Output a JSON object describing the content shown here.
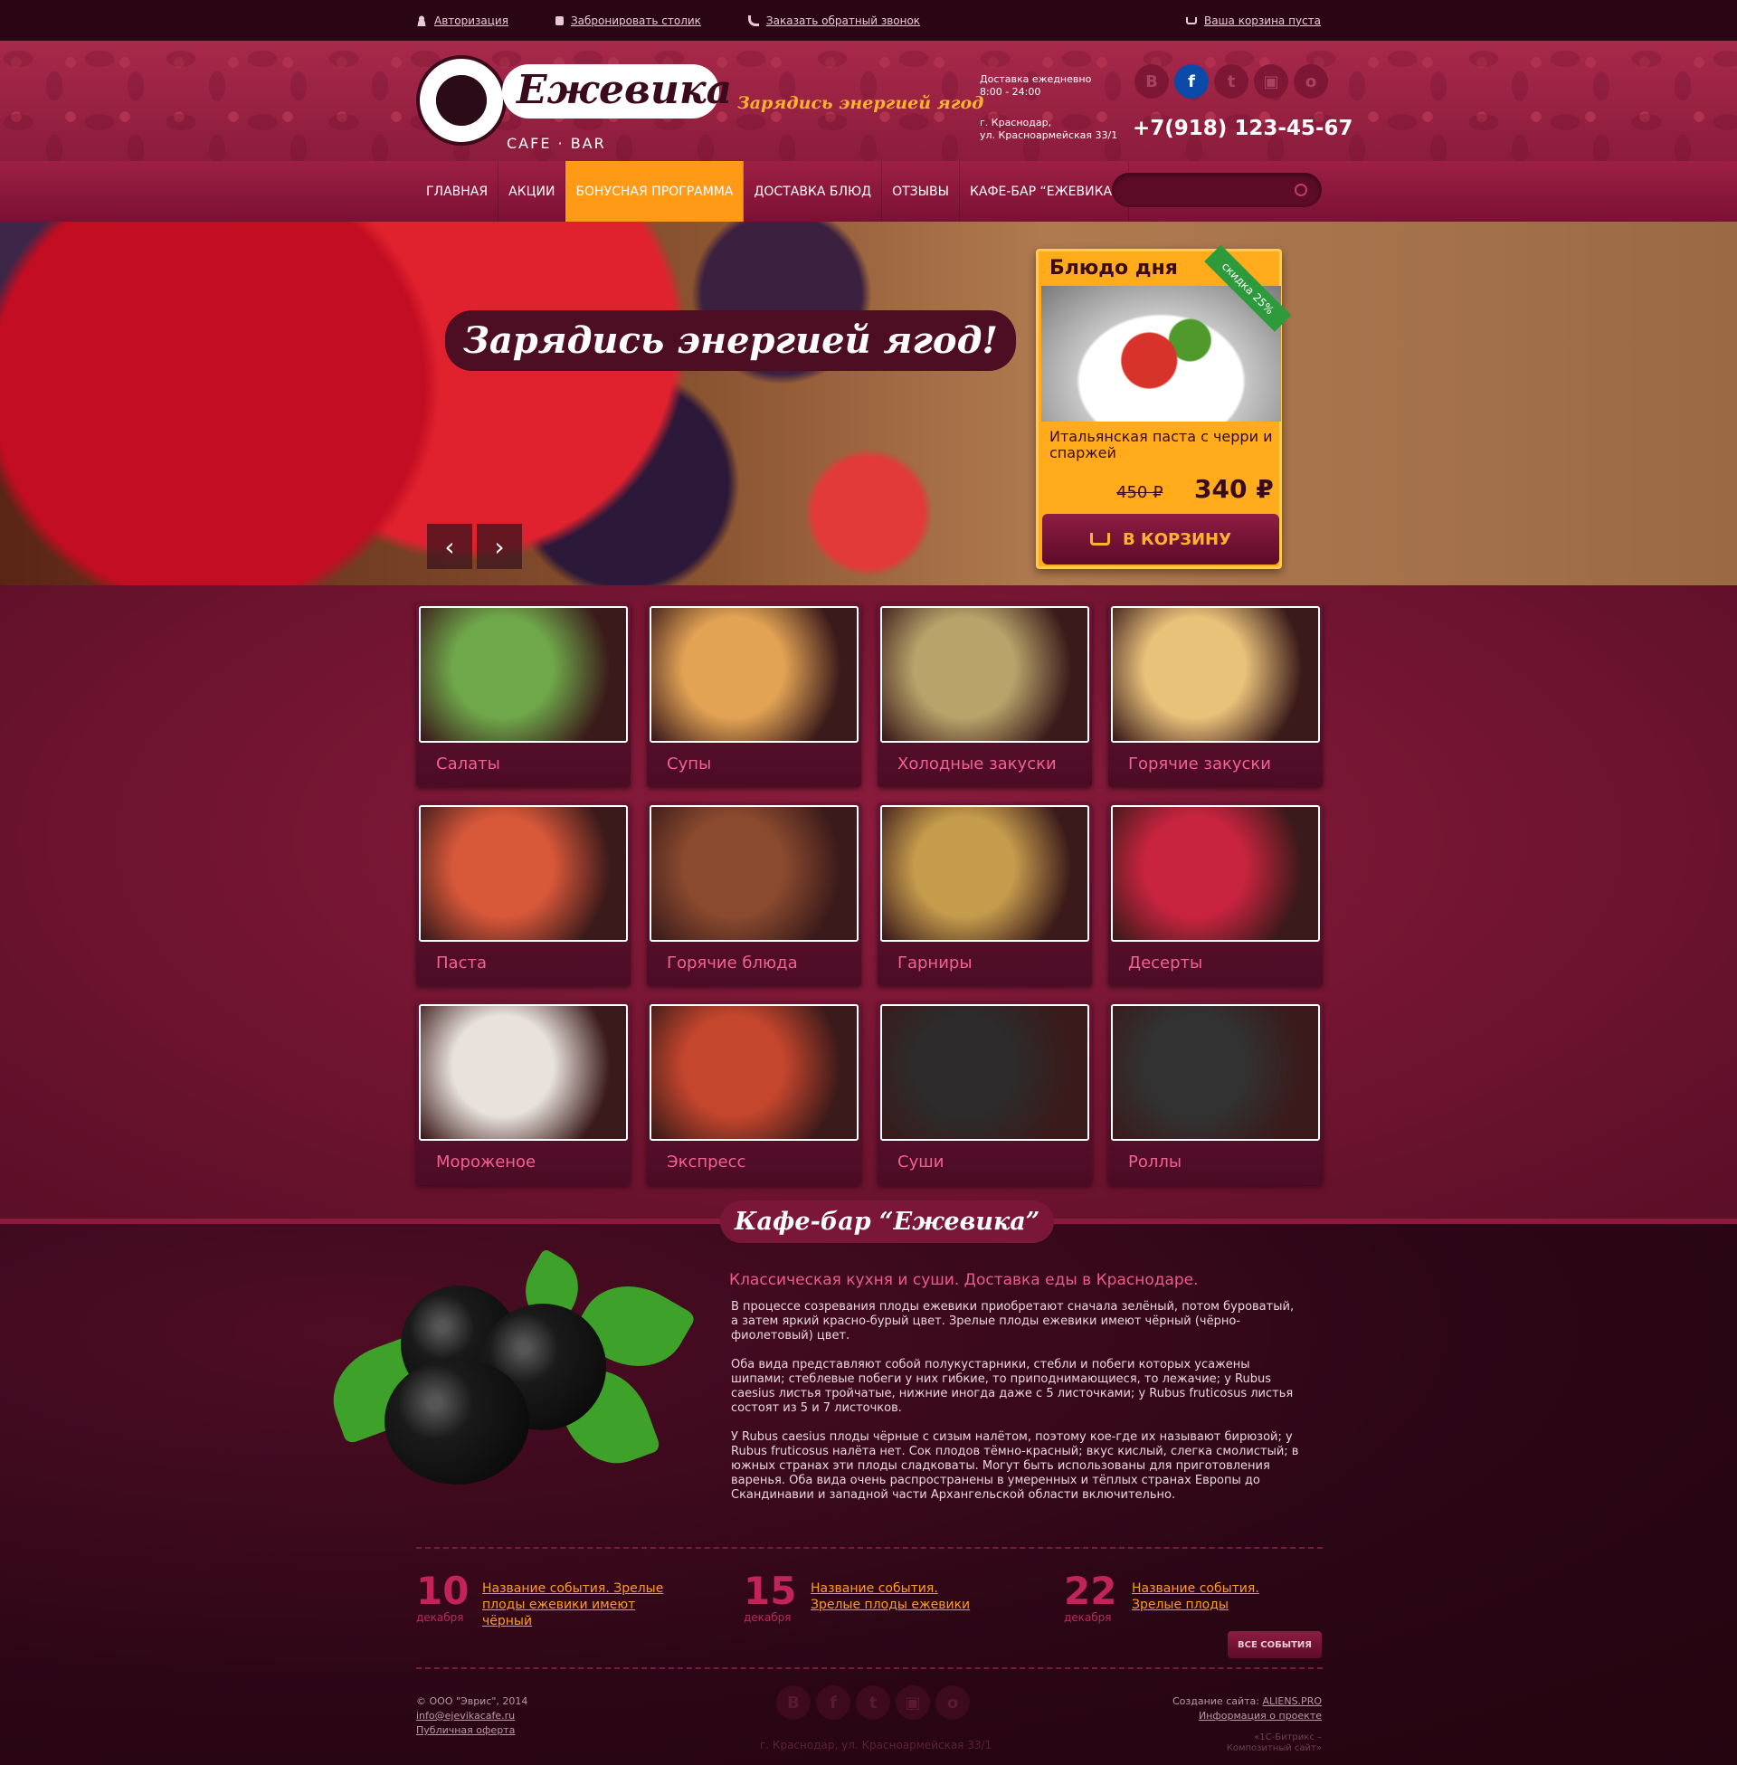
{
  "topbar": {
    "login": "Авторизация",
    "book": "Забронировать столик",
    "callback": "Заказать обратный звонок",
    "cart": "Ваша корзина пуста"
  },
  "header": {
    "logo_name": "Ежевика",
    "logo_sub": "CAFE · BAR",
    "slogan": "Зарядись энергией ягод",
    "hours_label": "Доставка ежедневно",
    "hours_value": "8:00 - 24:00",
    "city": "г. Краснодар,",
    "street": "ул. Красноармейская 33/1",
    "phone": "+7(918) 123-45-67",
    "social": [
      "В",
      "f",
      "t",
      "▣",
      "о"
    ]
  },
  "nav": {
    "items": [
      "ГЛАВНАЯ",
      "АКЦИИ",
      "БОНУСНАЯ ПРОГРАММА",
      "ДОСТАВКА БЛЮД",
      "ОТЗЫВЫ",
      "КАФЕ-БАР “ЕЖЕВИКА”"
    ],
    "active_index": 2,
    "search_placeholder": ""
  },
  "hero": {
    "headline": "Зарядись энергией ягод!",
    "prev": "‹",
    "next": "›",
    "dish": {
      "title": "Блюдо дня",
      "ribbon": "скидка 25%",
      "name": "Итальянская паста с черри и спаржей",
      "old_price": "450 ₽",
      "new_price": "340 ₽",
      "button": "В КОРЗИНУ"
    }
  },
  "categories": [
    "Салаты",
    "Супы",
    "Холодные закуски",
    "Горячие закуски",
    "Паста",
    "Горячие блюда",
    "Гарниры",
    "Десерты",
    "Мороженое",
    "Экспресс",
    "Суши",
    "Роллы"
  ],
  "category_colors": [
    "#6fa84a",
    "#e2a354",
    "#b8a36a",
    "#e9c27a",
    "#d8583a",
    "#8a4a2f",
    "#c59b4c",
    "#c8243f",
    "#e9e2dc",
    "#c4462d",
    "#2d2b2b",
    "#323232"
  ],
  "about": {
    "title": "Кафе-бар “Ежевика”",
    "lead": "Классическая кухня и суши. Доставка еды в Краснодаре.",
    "paragraphs": [
      "В процессе созревания плоды ежевики приобретают сначала зелёный, потом буроватый, а затем яркий красно-бурый цвет. Зрелые плоды ежевики имеют чёрный (чёрно-фиолетовый) цвет.",
      "Оба вида представляют собой полукустарники, стебли и побеги которых усажены шипами; стеблевые побеги у них гибкие, то приподнимающиеся, то лежачие; у Rubus caesius листья тройчатые, нижние иногда даже с 5 листочками; у Rubus fruticosus листья состоят из 5 и 7 листочков.",
      "У Rubus caesius плоды чёрные с сизым налётом, поэтому кое-где их называют бирюзой; у Rubus fruticosus налёта нет. Сок плодов тёмно-красный; вкус кислый, слегка смолистый; в южных странах эти плоды сладковаты. Могут быть использованы для приготовления варенья. Оба вида очень распространены в умеренных и тёплых странах Европы до Скандинавии и западной части Архангельской области включительно."
    ]
  },
  "events": [
    {
      "day": "10",
      "month": "декабря",
      "title": "Название события. Зрелые плоды ежевики имеют чёрный"
    },
    {
      "day": "15",
      "month": "декабря",
      "title": "Название события. Зрелые плоды ежевики"
    },
    {
      "day": "22",
      "month": "декабря",
      "title": "Название события. Зрелые плоды"
    }
  ],
  "all_events": "ВСЕ СОБЫТИЯ",
  "footer": {
    "copyright": "© ООО \"Эврис\", 2014",
    "email": "info@ejevikacafe.ru",
    "offer": "Публичная оферта",
    "address": "г. Краснодар, ул. Красноармейская 33/1",
    "made_by_label": "Создание сайта:",
    "made_by": "ALIENS.PRO",
    "project_info": "Информация о проекте",
    "bitrix": "«1С-Битрикс – Композитный сайт»",
    "social": [
      "В",
      "f",
      "t",
      "▣",
      "о"
    ]
  }
}
